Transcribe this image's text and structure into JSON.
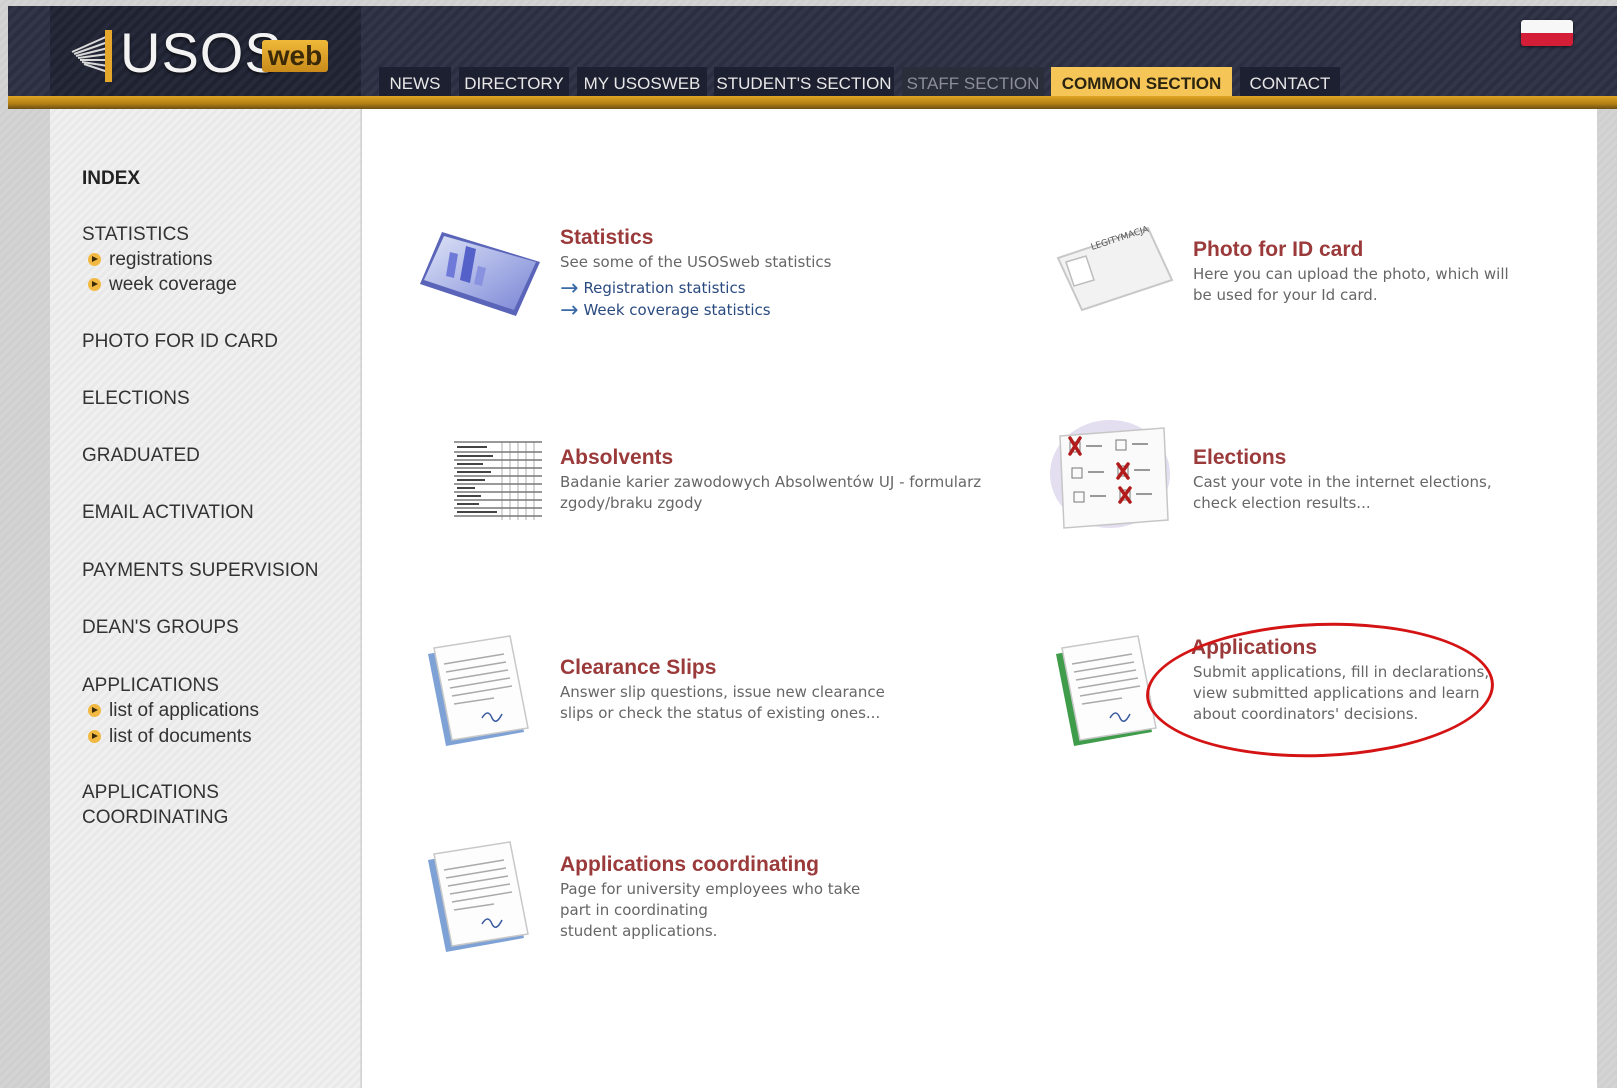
{
  "logo": {
    "text": "USOS",
    "badge": "web"
  },
  "nav": {
    "tabs": [
      {
        "label": "NEWS",
        "state": "normal"
      },
      {
        "label": "DIRECTORY",
        "state": "normal"
      },
      {
        "label": "MY USOSWEB",
        "state": "normal"
      },
      {
        "label": "STUDENT'S SECTION",
        "state": "normal"
      },
      {
        "label": "STAFF SECTION",
        "state": "disabled"
      },
      {
        "label": "COMMON SECTION",
        "state": "active"
      },
      {
        "label": "CONTACT",
        "state": "normal"
      }
    ]
  },
  "sidebar": {
    "index": "INDEX",
    "statistics": "STATISTICS",
    "statistics_sub": [
      "registrations",
      "week coverage"
    ],
    "photo": "PHOTO FOR ID CARD",
    "elections": "ELECTIONS",
    "graduated": "GRADUATED",
    "email": "EMAIL ACTIVATION",
    "payments": "PAYMENTS SUPERVISION",
    "deans": "DEAN'S GROUPS",
    "applications": "APPLICATIONS",
    "applications_sub": [
      "list of applications",
      "list of documents"
    ],
    "coordinating_line1": "APPLICATIONS",
    "coordinating_line2": "COORDINATING"
  },
  "cards": {
    "statistics": {
      "title": "Statistics",
      "desc": "See some of the USOSweb statistics",
      "links": [
        "Registration statistics",
        "Week coverage statistics"
      ]
    },
    "photo": {
      "title": "Photo for ID card",
      "desc_line1": "Here you can upload the photo, which will",
      "desc_line2": "be used for your Id card.",
      "icon_text": "LEGITYMACJA"
    },
    "absolvents": {
      "title": "Absolvents",
      "desc_line1": "Badanie karier zawodowych Absolwentów UJ - formularz",
      "desc_line2": "zgody/braku zgody"
    },
    "elections": {
      "title": "Elections",
      "desc_line1": "Cast your vote in the internet elections,",
      "desc_line2": "check election results..."
    },
    "clearance": {
      "title": "Clearance Slips",
      "desc_line1": "Answer slip questions, issue new clearance",
      "desc_line2": "slips or check the status of existing ones..."
    },
    "applications": {
      "title": "Applications",
      "desc_line1": "Submit applications, fill in declarations,",
      "desc_line2": "view submitted applications and learn",
      "desc_line3": "about coordinators' decisions."
    },
    "coordinating": {
      "title": "Applications coordinating",
      "desc_line1": "Page for university employees who take",
      "desc_line2": "part in coordinating",
      "desc_line3": "student applications."
    }
  },
  "colors": {
    "header_bg": "#2a2e40",
    "accent_gold": "#f5c558",
    "title_red": "#9b3a3a",
    "link_blue": "#2a4a80",
    "highlight_red": "#d41414"
  }
}
